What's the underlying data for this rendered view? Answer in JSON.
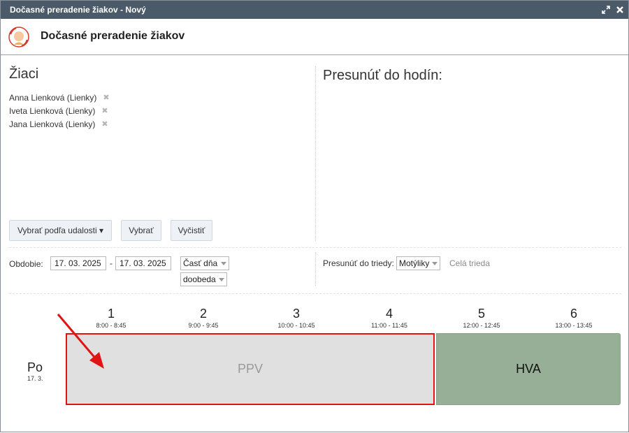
{
  "window": {
    "title": "Dočasné preradenie žiakov - Nový",
    "header_title": "Dočasné preradenie žiakov"
  },
  "left": {
    "heading": "Žiaci",
    "students": [
      {
        "name": "Anna Lienková (Lienky)"
      },
      {
        "name": "Iveta Lienková (Lienky)"
      },
      {
        "name": "Jana Lienková (Lienky)"
      }
    ],
    "remove_glyph": "✖",
    "buttons": {
      "by_event": "Vybrať podľa udalosti ▾",
      "select": "Vybrať",
      "clear": "Vyčistiť"
    }
  },
  "right": {
    "heading": "Presunúť do hodín:"
  },
  "filters": {
    "period_label": "Obdobie:",
    "date_from": "17. 03. 2025",
    "date_sep": "-",
    "date_to": "17. 03. 2025",
    "day_part": "Časť dňa",
    "day_half": "doobeda",
    "move_to_class_label": "Presunúť do triedy:",
    "class_value": "Motýliky",
    "whole_class": "Celá trieda"
  },
  "schedule": {
    "periods": [
      {
        "num": "1",
        "time": "8:00 - 8:45"
      },
      {
        "num": "2",
        "time": "9:00 - 9:45"
      },
      {
        "num": "3",
        "time": "10:00 - 10:45"
      },
      {
        "num": "4",
        "time": "11:00 - 11:45"
      },
      {
        "num": "5",
        "time": "12:00 - 12:45"
      },
      {
        "num": "6",
        "time": "13:00 - 13:45"
      }
    ],
    "day": {
      "name": "Po",
      "date": "17. 3."
    },
    "blocks": [
      {
        "label": "PPV",
        "color": "#e0e0e0",
        "highlight": "#e11414"
      },
      {
        "label": "HVA",
        "color": "#97ae97"
      }
    ]
  },
  "colors": {
    "titlebar": "#4b5a68",
    "annotation": "#e11414"
  }
}
